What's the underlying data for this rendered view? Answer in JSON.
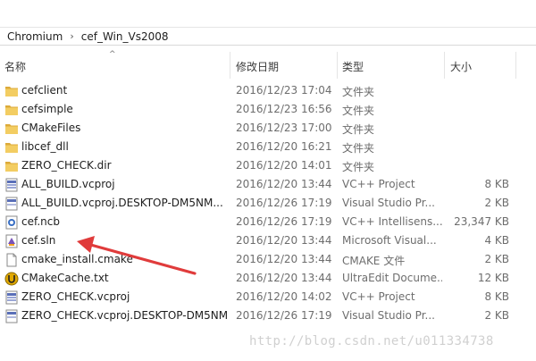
{
  "breadcrumb": {
    "items": [
      "Chromium",
      "cef_Win_Vs2008"
    ],
    "separator": "›"
  },
  "columns": {
    "name": "名称",
    "date": "修改日期",
    "type": "类型",
    "size": "大小"
  },
  "files": [
    {
      "name": "cefclient",
      "date": "2016/12/23 17:04",
      "type": "文件夹",
      "size": "",
      "icon": "folder-icon"
    },
    {
      "name": "cefsimple",
      "date": "2016/12/23 16:56",
      "type": "文件夹",
      "size": "",
      "icon": "folder-icon"
    },
    {
      "name": "CMakeFiles",
      "date": "2016/12/23 17:00",
      "type": "文件夹",
      "size": "",
      "icon": "folder-icon"
    },
    {
      "name": "libcef_dll",
      "date": "2016/12/20 16:21",
      "type": "文件夹",
      "size": "",
      "icon": "folder-icon"
    },
    {
      "name": "ZERO_CHECK.dir",
      "date": "2016/12/20 14:01",
      "type": "文件夹",
      "size": "",
      "icon": "folder-icon"
    },
    {
      "name": "ALL_BUILD.vcproj",
      "date": "2016/12/20 13:44",
      "type": "VC++ Project",
      "size": "8 KB",
      "icon": "vcproj-icon"
    },
    {
      "name": "ALL_BUILD.vcproj.DESKTOP-DM5NM...",
      "date": "2016/12/26 17:19",
      "type": "Visual Studio Pr...",
      "size": "2 KB",
      "icon": "vs-user-file-icon"
    },
    {
      "name": "cef.ncb",
      "date": "2016/12/26 17:19",
      "type": "VC++ Intellisens...",
      "size": "23,347 KB",
      "icon": "ncb-file-icon"
    },
    {
      "name": "cef.sln",
      "date": "2016/12/20 13:44",
      "type": "Microsoft Visual...",
      "size": "4 KB",
      "icon": "sln-file-icon"
    },
    {
      "name": "cmake_install.cmake",
      "date": "2016/12/20 13:44",
      "type": "CMAKE 文件",
      "size": "2 KB",
      "icon": "blank-file-icon"
    },
    {
      "name": "CMakeCache.txt",
      "date": "2016/12/20 13:44",
      "type": "UltraEdit Docume...",
      "size": "12 KB",
      "icon": "ultraedit-file-icon"
    },
    {
      "name": "ZERO_CHECK.vcproj",
      "date": "2016/12/20 14:02",
      "type": "VC++ Project",
      "size": "8 KB",
      "icon": "vcproj-icon"
    },
    {
      "name": "ZERO_CHECK.vcproj.DESKTOP-DM5NM...",
      "date": "2016/12/26 17:19",
      "type": "Visual Studio Pr...",
      "size": "2 KB",
      "icon": "vs-user-file-icon"
    }
  ],
  "watermark": "http://blog.csdn.net/u011334738",
  "colors": {
    "folder": "#e8b94a",
    "arrow": "#e03b3b",
    "watermark": "#d0d0d0"
  }
}
